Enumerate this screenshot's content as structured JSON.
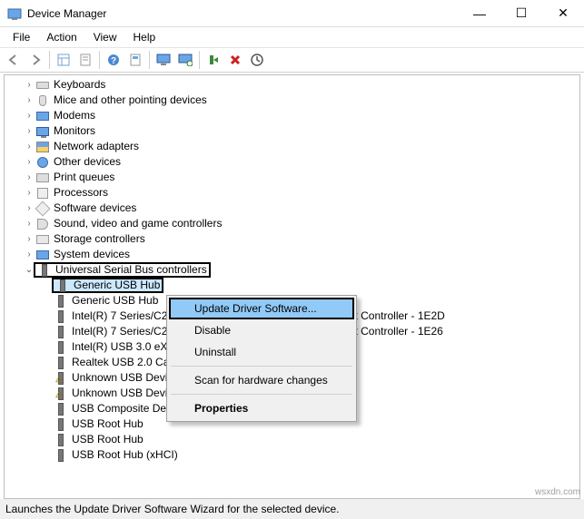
{
  "window": {
    "title": "Device Manager"
  },
  "menubar": {
    "file": "File",
    "action": "Action",
    "view": "View",
    "help": "Help"
  },
  "toolbar": {
    "back": "←",
    "forward": "→",
    "list": "list-icon",
    "details": "details-icon",
    "help": "help-icon",
    "props": "properties-icon",
    "monitor": "monitor-icon",
    "scan": "scan-icon",
    "remove": "✕",
    "update": "update-icon"
  },
  "tree": {
    "categories": [
      {
        "label": "Keyboards",
        "icon": "keyboard"
      },
      {
        "label": "Mice and other pointing devices",
        "icon": "mouse"
      },
      {
        "label": "Modems",
        "icon": "modem"
      },
      {
        "label": "Monitors",
        "icon": "monitor"
      },
      {
        "label": "Network adapters",
        "icon": "network"
      },
      {
        "label": "Other devices",
        "icon": "other"
      },
      {
        "label": "Print queues",
        "icon": "printer"
      },
      {
        "label": "Processors",
        "icon": "cpu"
      },
      {
        "label": "Software devices",
        "icon": "software"
      },
      {
        "label": "Sound, video and game controllers",
        "icon": "sound"
      },
      {
        "label": "Storage controllers",
        "icon": "storage"
      },
      {
        "label": "System devices",
        "icon": "system"
      }
    ],
    "usb_header": "Universal Serial Bus controllers",
    "usb_items": [
      {
        "label": "Generic USB Hub",
        "selected": true
      },
      {
        "label": "Generic USB Hub"
      },
      {
        "label": "Intel(R) 7 Series/C216 Chipset Family USB Enhanced Host Controller - 1E2D"
      },
      {
        "label": "Intel(R) 7 Series/C216 Chipset Family USB Enhanced Host Controller - 1E26"
      },
      {
        "label": "Intel(R) USB 3.0 eXtensible Host Controller"
      },
      {
        "label": "Realtek USB 2.0 Card Reader"
      },
      {
        "label": "Unknown USB Device",
        "warn": true
      },
      {
        "label": "Unknown USB Device",
        "warn": true
      },
      {
        "label": "USB Composite Device"
      },
      {
        "label": "USB Root Hub"
      },
      {
        "label": "USB Root Hub"
      },
      {
        "label": "USB Root Hub (xHCI)"
      }
    ]
  },
  "contextmenu": {
    "update": "Update Driver Software...",
    "disable": "Disable",
    "uninstall": "Uninstall",
    "scan": "Scan for hardware changes",
    "properties": "Properties"
  },
  "statusbar": "Launches the Update Driver Software Wizard for the selected device.",
  "watermark": "wsxdn.com"
}
